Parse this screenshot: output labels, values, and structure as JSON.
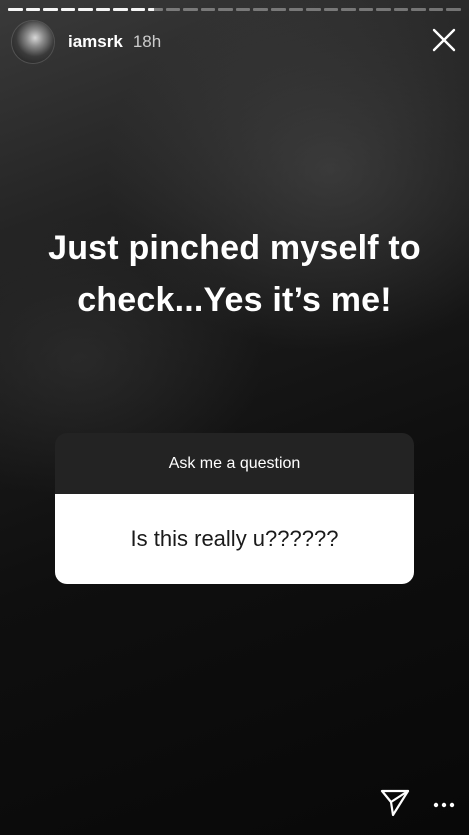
{
  "story": {
    "progress": {
      "segments": 26,
      "active_segment": 8,
      "active_fill": 0.4
    },
    "user": {
      "username": "iamsrk",
      "time_ago": "18h"
    },
    "caption": "Just pinched myself to check...Yes it’s me!",
    "question_sticker": {
      "prompt": "Ask me a question",
      "answer": "Is this really u??????"
    },
    "icons": {
      "close": "close-icon",
      "share": "send-icon",
      "more": "more-options-icon"
    }
  }
}
